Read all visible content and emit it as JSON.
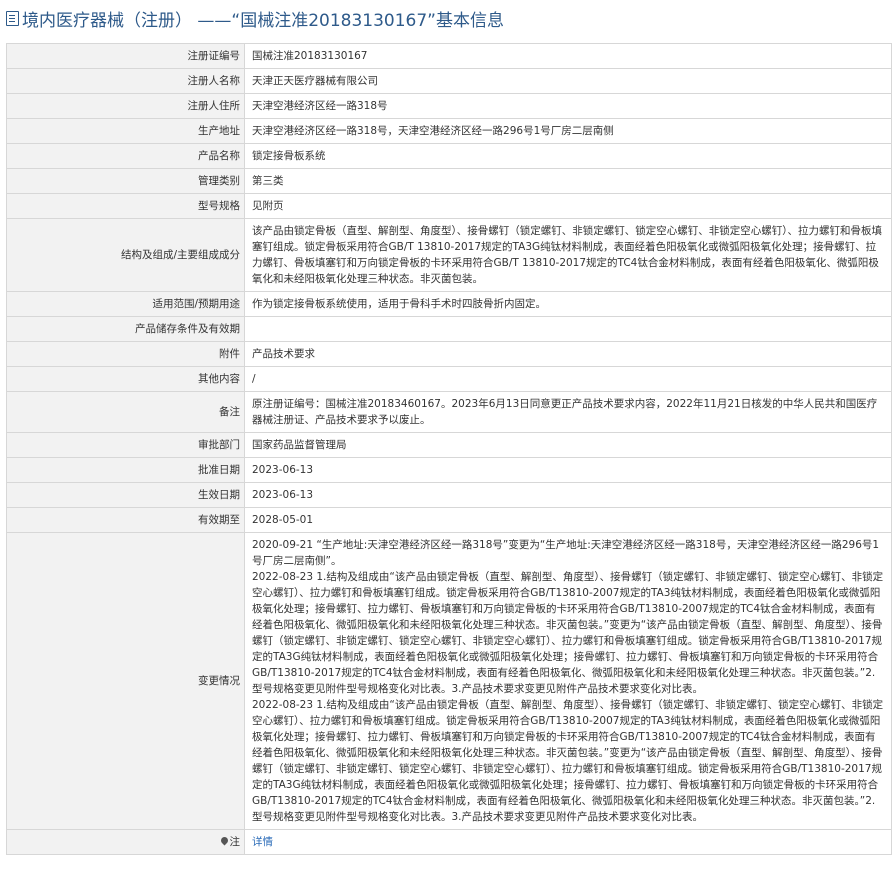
{
  "page_title": "境内医疗器械（注册） ——“国械注准20183130167”基本信息",
  "rows": [
    {
      "label": "注册证编号",
      "value": "国械注准20183130167"
    },
    {
      "label": "注册人名称",
      "value": "天津正天医疗器械有限公司"
    },
    {
      "label": "注册人住所",
      "value": "天津空港经济区经一路318号"
    },
    {
      "label": "生产地址",
      "value": "天津空港经济区经一路318号，天津空港经济区经一路296号1号厂房二层南侧"
    },
    {
      "label": "产品名称",
      "value": "锁定接骨板系统"
    },
    {
      "label": "管理类别",
      "value": "第三类"
    },
    {
      "label": "型号规格",
      "value": "见附页"
    },
    {
      "label": "结构及组成/主要组成成分",
      "value": "该产品由锁定骨板（直型、解剖型、角度型）、接骨螺钉（锁定螺钉、非锁定螺钉、锁定空心螺钉、非锁定空心螺钉）、拉力螺钉和骨板填塞钉组成。锁定骨板采用符合GB/T 13810-2017规定的TA3G纯钛材料制成，表面经着色阳极氧化或微弧阳极氧化处理；接骨螺钉、拉力螺钉、骨板填塞钉和万向锁定骨板的卡环采用符合GB/T 13810-2017规定的TC4钛合金材料制成，表面有经着色阳极氧化、微弧阳极氧化和未经阳极氧化处理三种状态。非灭菌包装。"
    },
    {
      "label": "适用范围/预期用途",
      "value": "作为锁定接骨板系统使用，适用于骨科手术时四肢骨折内固定。"
    },
    {
      "label": "产品储存条件及有效期",
      "value": ""
    },
    {
      "label": "附件",
      "value": "产品技术要求"
    },
    {
      "label": "其他内容",
      "value": "/"
    },
    {
      "label": "备注",
      "value": "原注册证编号：国械注准20183460167。2023年6月13日同意更正产品技术要求内容，2022年11月21日核发的中华人民共和国医疗器械注册证、产品技术要求予以废止。"
    },
    {
      "label": "审批部门",
      "value": "国家药品监督管理局"
    },
    {
      "label": "批准日期",
      "value": "2023-06-13"
    },
    {
      "label": "生效日期",
      "value": "2023-06-13"
    },
    {
      "label": "有效期至",
      "value": "2028-05-01"
    }
  ],
  "changes": {
    "label": "变更情况",
    "entries": [
      "2020-09-21 “生产地址:天津空港经济区经一路318号”变更为“生产地址:天津空港经济区经一路318号，天津空港经济区经一路296号1号厂房二层南侧”。",
      "2022-08-23 1.结构及组成由“该产品由锁定骨板（直型、解剖型、角度型）、接骨螺钉（锁定螺钉、非锁定螺钉、锁定空心螺钉、非锁定空心螺钉）、拉力螺钉和骨板填塞钉组成。锁定骨板采用符合GB/T13810-2007规定的TA3纯钛材料制成，表面经着色阳极氧化或微弧阳极氧化处理；接骨螺钉、拉力螺钉、骨板填塞钉和万向锁定骨板的卡环采用符合GB/T13810-2007规定的TC4钛合金材料制成，表面有经着色阳极氧化、微弧阳极氧化和未经阳极氧化处理三种状态。非灭菌包装。”变更为“该产品由锁定骨板（直型、解剖型、角度型）、接骨螺钉（锁定螺钉、非锁定螺钉、锁定空心螺钉、非锁定空心螺钉）、拉力螺钉和骨板填塞钉组成。锁定骨板采用符合GB/T13810-2017规定的TA3G纯钛材料制成，表面经着色阳极氧化或微弧阳极氧化处理；接骨螺钉、拉力螺钉、骨板填塞钉和万向锁定骨板的卡环采用符合GB/T13810-2017规定的TC4钛合金材料制成，表面有经着色阳极氧化、微弧阳极氧化和未经阳极氧化处理三种状态。非灭菌包装。”2.型号规格变更见附件型号规格变化对比表。3.产品技术要求变更见附件产品技术要求变化对比表。",
      "2022-08-23 1.结构及组成由“该产品由锁定骨板（直型、解剖型、角度型）、接骨螺钉（锁定螺钉、非锁定螺钉、锁定空心螺钉、非锁定空心螺钉）、拉力螺钉和骨板填塞钉组成。锁定骨板采用符合GB/T13810-2007规定的TA3纯钛材料制成，表面经着色阳极氧化或微弧阳极氧化处理；接骨螺钉、拉力螺钉、骨板填塞钉和万向锁定骨板的卡环采用符合GB/T13810-2007规定的TC4钛合金材料制成，表面有经着色阳极氧化、微弧阳极氧化和未经阳极氧化处理三种状态。非灭菌包装。”变更为“该产品由锁定骨板（直型、解剖型、角度型）、接骨螺钉（锁定螺钉、非锁定螺钉、锁定空心螺钉、非锁定空心螺钉）、拉力螺钉和骨板填塞钉组成。锁定骨板采用符合GB/T13810-2017规定的TA3G纯钛材料制成，表面经着色阳极氧化或微弧阳极氧化处理；接骨螺钉、拉力螺钉、骨板填塞钉和万向锁定骨板的卡环采用符合GB/T13810-2017规定的TC4钛合金材料制成，表面有经着色阳极氧化、微弧阳极氧化和未经阳极氧化处理三种状态。非灭菌包装。”2.型号规格变更见附件型号规格变化对比表。3.产品技术要求变更见附件产品技术要求变化对比表。"
    ]
  },
  "note": {
    "label": "注",
    "link_text": "详情"
  }
}
